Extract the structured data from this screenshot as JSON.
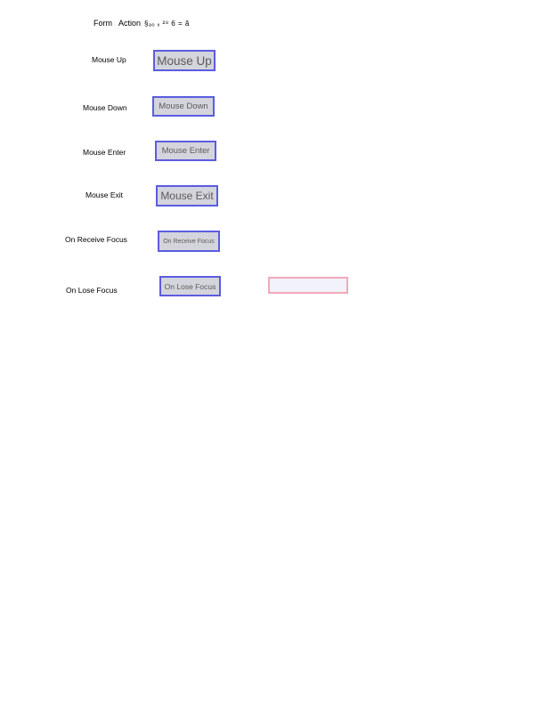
{
  "header": {
    "form": "Form",
    "action": "Action",
    "glyphs": "§ₐₒ ₓ  ²⁸ 6  =    ã"
  },
  "rows": [
    {
      "label": "Mouse Up",
      "button": "Mouse Up"
    },
    {
      "label": "Mouse Down",
      "button": "Mouse Down"
    },
    {
      "label": "Mouse Enter",
      "button": "Mouse Enter"
    },
    {
      "label": "Mouse Exit",
      "button": "Mouse Exit"
    },
    {
      "label": "On Receive Focus",
      "button": "On Receive Focus"
    },
    {
      "label": "On Lose Focus",
      "button": "On Lose Focus"
    }
  ],
  "text_field": {
    "value": ""
  },
  "colors": {
    "button_border": "#5c5ce0",
    "button_fill": "#d4d4dc",
    "field_border": "#f2a9b9"
  }
}
